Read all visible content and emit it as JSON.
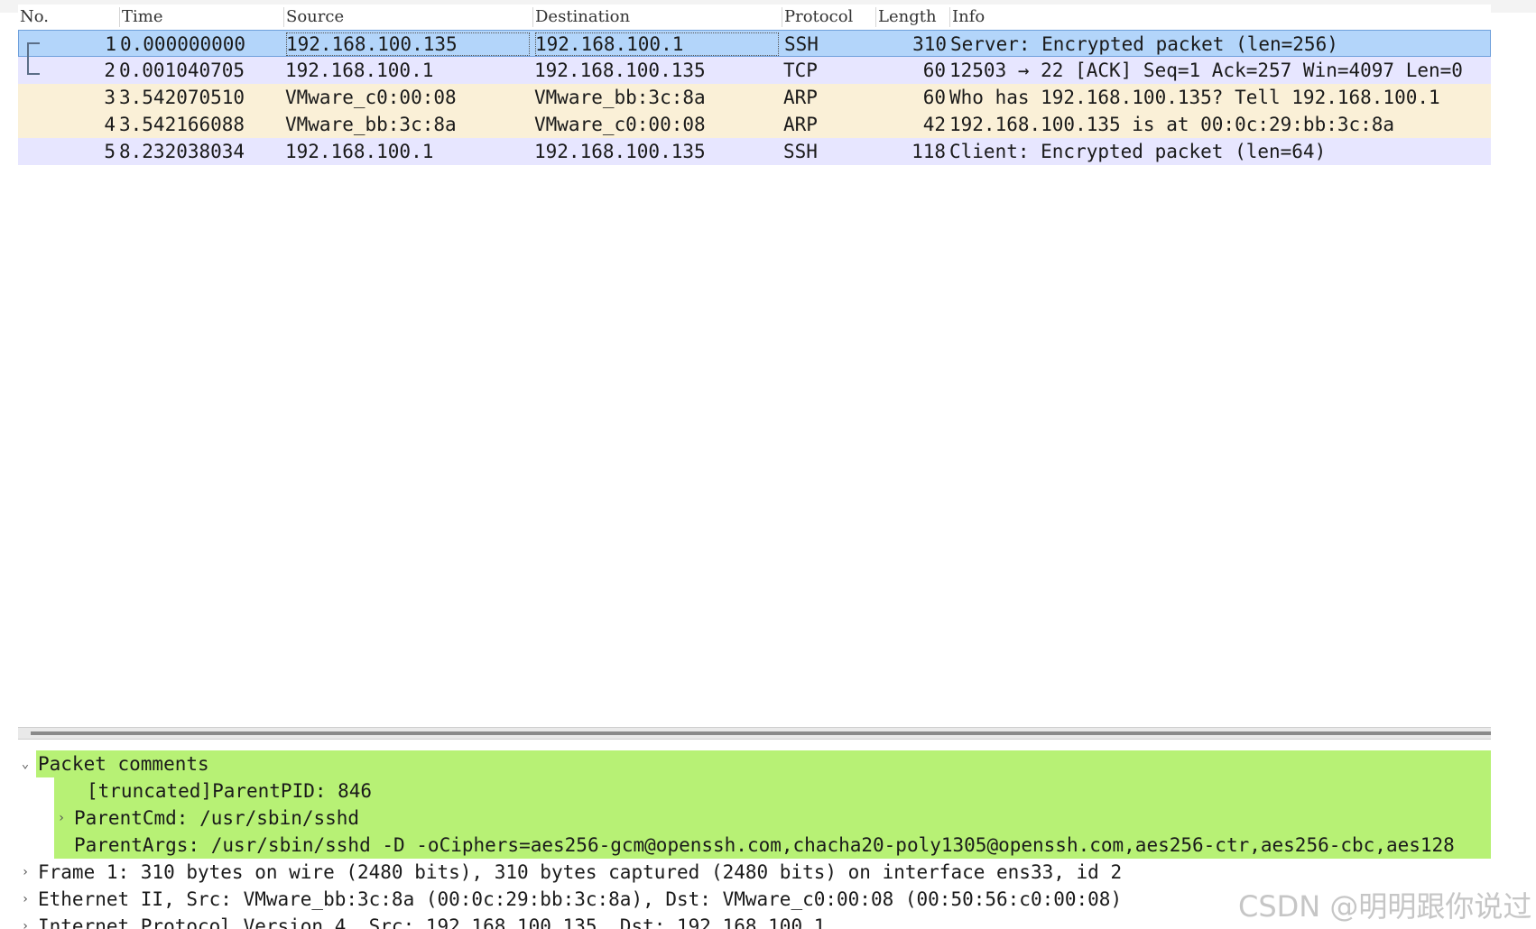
{
  "packet_list": {
    "columns": [
      "No.",
      "Time",
      "Source",
      "Destination",
      "Protocol",
      "Length",
      "Info"
    ],
    "rows": [
      {
        "no": "1",
        "time": "0.000000000",
        "source": "192.168.100.135",
        "destination": "192.168.100.1",
        "protocol": "SSH",
        "length": "310",
        "info": "Server: Encrypted packet (len=256)"
      },
      {
        "no": "2",
        "time": "0.001040705",
        "source": "192.168.100.1",
        "destination": "192.168.100.135",
        "protocol": "TCP",
        "length": "60",
        "info": "12503 → 22 [ACK] Seq=1 Ack=257 Win=4097 Len=0"
      },
      {
        "no": "3",
        "time": "3.542070510",
        "source": "VMware_c0:00:08",
        "destination": "VMware_bb:3c:8a",
        "protocol": "ARP",
        "length": "60",
        "info": "Who has 192.168.100.135? Tell 192.168.100.1"
      },
      {
        "no": "4",
        "time": "3.542166088",
        "source": "VMware_bb:3c:8a",
        "destination": "VMware_c0:00:08",
        "protocol": "ARP",
        "length": "42",
        "info": "192.168.100.135 is at 00:0c:29:bb:3c:8a"
      },
      {
        "no": "5",
        "time": "8.232038034",
        "source": "192.168.100.1",
        "destination": "192.168.100.135",
        "protocol": "SSH",
        "length": "118",
        "info": "Client: Encrypted packet (len=64)"
      }
    ]
  },
  "details": {
    "packet_comments": "Packet comments",
    "parent_pid": "[truncated]ParentPID: 846",
    "parent_cmd": "ParentCmd: /usr/sbin/sshd",
    "parent_args": "ParentArgs: /usr/sbin/sshd -D -oCiphers=aes256-gcm@openssh.com,chacha20-poly1305@openssh.com,aes256-ctr,aes256-cbc,aes128",
    "frame": "Frame 1: 310 bytes on wire (2480 bits), 310 bytes captured (2480 bits) on interface ens33, id 2",
    "ethernet": "Ethernet II, Src: VMware_bb:3c:8a (00:0c:29:bb:3c:8a), Dst: VMware_c0:00:08 (00:50:56:c0:00:08)",
    "ip": "Internet Protocol Version 4, Src: 192.168.100.135, Dst: 192.168.100.1"
  },
  "watermark": "CSDN @明明跟你说过",
  "colors": {
    "selected_row": "#b3d5fa",
    "tcp_row": "#e7e6ff",
    "arp_row": "#faf0d7",
    "comment_highlight": "#b7f175"
  },
  "icons": {
    "expanded": "chevron-down-icon",
    "collapsed": "chevron-right-icon"
  }
}
